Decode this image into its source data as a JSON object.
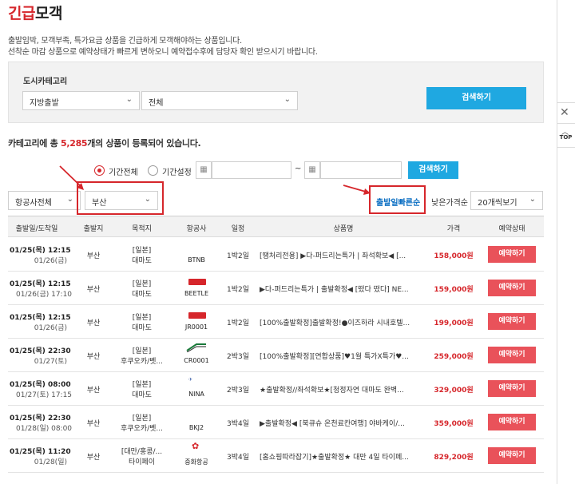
{
  "page": {
    "title_accent": "긴급",
    "title_rest": "모객",
    "desc1": "출발임박, 모객부족, 특가요금 상품을 긴급하게 모객해야하는 상품입니다.",
    "desc2": "선착순 마감 상품으로 예약상태가 빠르게 변하오니 예약접수후에 담당자 확인 받으시기 바랍니다."
  },
  "search": {
    "category_label": "도시카테고리",
    "region_select": "지방출발",
    "city_select": "전체",
    "search_button": "검색하기"
  },
  "side": {
    "close_glyph": "✕",
    "top_label": "TOP",
    "top_arrow": "︿"
  },
  "count": {
    "prefix": "카테고리에 총 ",
    "number": "5,285",
    "suffix": "개의 상품이 등록되어 있습니다."
  },
  "filter": {
    "radio_all": "기간전체",
    "radio_set": "기간설정",
    "tilde": "~",
    "search_button": "검색하기",
    "airline_select": "항공사전체",
    "departure_select": "부산",
    "sort_fast": "출발일빠른순",
    "sort_cheap": "낮은가격순",
    "page_size_select": "20개씩보기"
  },
  "table": {
    "headers": [
      "출발일/도착일",
      "출발지",
      "목적지",
      "항공사",
      "일정",
      "상품명",
      "가격",
      "예약상태"
    ],
    "rows": [
      {
        "dep": "01/25(목) 12:15",
        "arr": "01/26(금)",
        "from": "부산",
        "to1": "[일본]",
        "to2": "대마도",
        "airline": "BTNB",
        "logo": "none",
        "days": "1박2일",
        "product": "[땡처리전용] ▶다-퍼드리는특가 | 좌석확보◀ [...",
        "price": "158,000원",
        "status": "예약하기"
      },
      {
        "dep": "01/25(목) 12:15",
        "arr": "01/26(금) 17:10",
        "from": "부산",
        "to1": "[일본]",
        "to2": "대마도",
        "airline": "BEETLE",
        "logo": "box",
        "days": "1박2일",
        "product": "▶다-퍼드리는특가 | 출발확정◀ [떴다 떴다] NE...",
        "price": "159,000원",
        "status": "예약하기"
      },
      {
        "dep": "01/25(목) 12:15",
        "arr": "01/26(금)",
        "from": "부산",
        "to1": "[일본]",
        "to2": "대마도",
        "airline": "JR0001",
        "logo": "box",
        "days": "1박2일",
        "product": "[100%출발확정]출발확정!●이즈하라 시내호텔...",
        "price": "199,000원",
        "status": "예약하기"
      },
      {
        "dep": "01/25(목) 22:30",
        "arr": "01/27(토)",
        "from": "부산",
        "to1": "[일본]",
        "to2": "후쿠오카/벳...",
        "airline": "CR0001",
        "logo": "stripe",
        "days": "2박3일",
        "product": "[100%출발확정][연합상품]♥1월 특가X특가♥...",
        "price": "259,000원",
        "status": "예약하기"
      },
      {
        "dep": "01/25(목) 08:00",
        "arr": "01/27(토) 17:15",
        "from": "부산",
        "to1": "[일본]",
        "to2": "대마도",
        "airline": "NINA",
        "logo": "small",
        "days": "2박3일",
        "product": "★출발확정//좌석확보★[청정자연 대마도 완벽...",
        "price": "329,000원",
        "status": "예약하기"
      },
      {
        "dep": "01/25(목) 22:30",
        "arr": "01/28(일) 08:00",
        "from": "부산",
        "to1": "[일본]",
        "to2": "후쿠오카/벳...",
        "airline": "BKJ2",
        "logo": "none",
        "days": "3박4일",
        "product": "▶출발확정◀ [북큐슈 온천료칸여행] 야바케이/...",
        "price": "359,000원",
        "status": "예약하기"
      },
      {
        "dep": "01/25(목) 11:20",
        "arr": "01/28(일)",
        "from": "부산",
        "to1": "[대만/홍콩/...",
        "to2": "타이페이",
        "airline": "중화항공",
        "logo": "flower",
        "days": "3박4일",
        "product": "[홈쇼핑따라잡기]★출발확정★ 대만 4일 타이페...",
        "price": "829,200원",
        "status": "예약하기"
      }
    ]
  },
  "colors": {
    "accent_red": "#d6262b",
    "button_blue": "#1fa8e1",
    "reserve_red": "#e9525a",
    "sort_blue": "#0a6ec2"
  }
}
